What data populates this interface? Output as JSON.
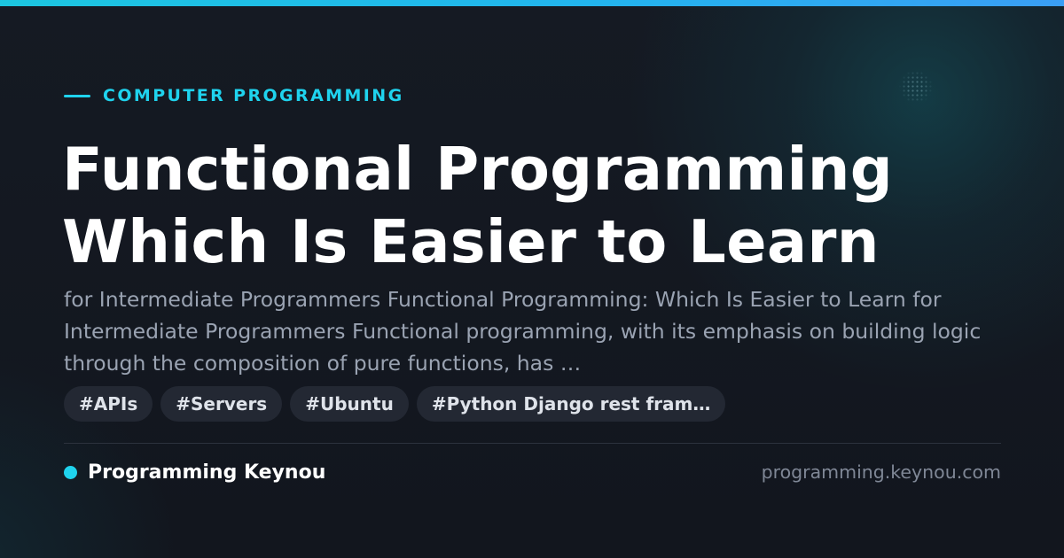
{
  "colors": {
    "accent": "#1fd3ee",
    "background": "#141820",
    "title": "#ffffff",
    "description": "#9aa3b2",
    "tag_background": "#232833",
    "tag_text": "#dfe3ea",
    "domain_text": "#7f8796"
  },
  "category": {
    "label": "COMPUTER PROGRAMMING"
  },
  "title": {
    "line1": "Functional Programming",
    "line2": "Which Is Easier to Learn"
  },
  "description": "for Intermediate Programmers Functional Programming: Which Is Easier to Learn for Intermediate Programmers Functional programming, with its emphasis on building logic through the composition of pure functions, has …",
  "tags": [
    "#APIs",
    "#Servers",
    "#Ubuntu",
    "#Python Django rest fram…"
  ],
  "footer": {
    "brand": "Programming Keynou",
    "domain": "programming.keynou.com"
  }
}
